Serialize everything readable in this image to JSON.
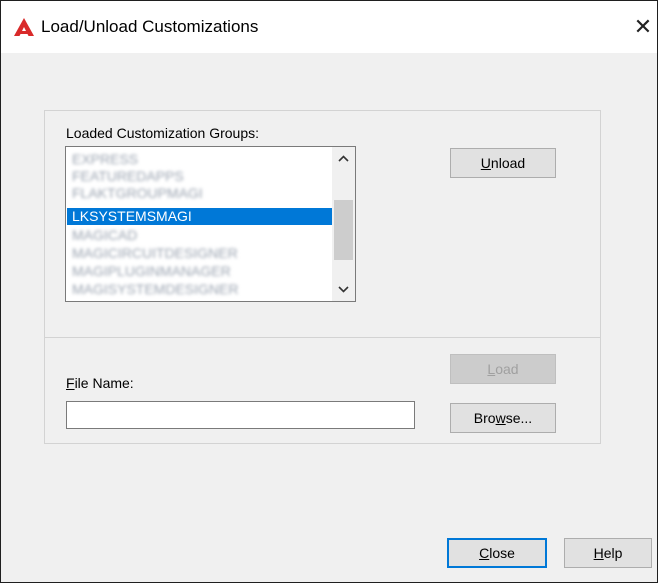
{
  "window": {
    "title": "Load/Unload Customizations",
    "close_glyph": "✕"
  },
  "groups": {
    "label_prefix": "",
    "label": "Loaded Customization Groups:",
    "items": [
      {
        "text": "EXPRESS",
        "state": "blurred"
      },
      {
        "text": "FEATUREDAPPS",
        "state": "blurred"
      },
      {
        "text": "FLAKTGROUPMAGI",
        "state": "blurred"
      },
      {
        "text": "LKSYSTEMSMAGI",
        "state": "selected"
      },
      {
        "text": "MAGICAD",
        "state": "blurred"
      },
      {
        "text": "MAGICIRCUITDESIGNER",
        "state": "blurred"
      },
      {
        "text": "MAGIPLUGINMANAGER",
        "state": "blurred"
      },
      {
        "text": "MAGISYSTEMDESIGNER",
        "state": "blurred"
      }
    ]
  },
  "buttons": {
    "unload": {
      "mnemonic": "U",
      "rest": "nload"
    },
    "load": {
      "mnemonic": "L",
      "rest": "oad",
      "enabled": false
    },
    "browse": {
      "pre": "Bro",
      "mnemonic": "w",
      "rest": "se..."
    },
    "close": {
      "mnemonic": "C",
      "rest": "lose"
    },
    "help": {
      "mnemonic": "H",
      "rest": "elp"
    }
  },
  "file_name": {
    "label_mnemonic": "F",
    "label_rest": "ile Name:",
    "value": ""
  },
  "icons": {
    "app": "autocad-logo-icon",
    "scroll_up": "chevron-up-icon",
    "scroll_down": "chevron-down-icon",
    "close": "close-icon"
  },
  "colors": {
    "selection": "#0078d7",
    "logo": "#d92a2a",
    "default_button_border": "#0078d7"
  }
}
